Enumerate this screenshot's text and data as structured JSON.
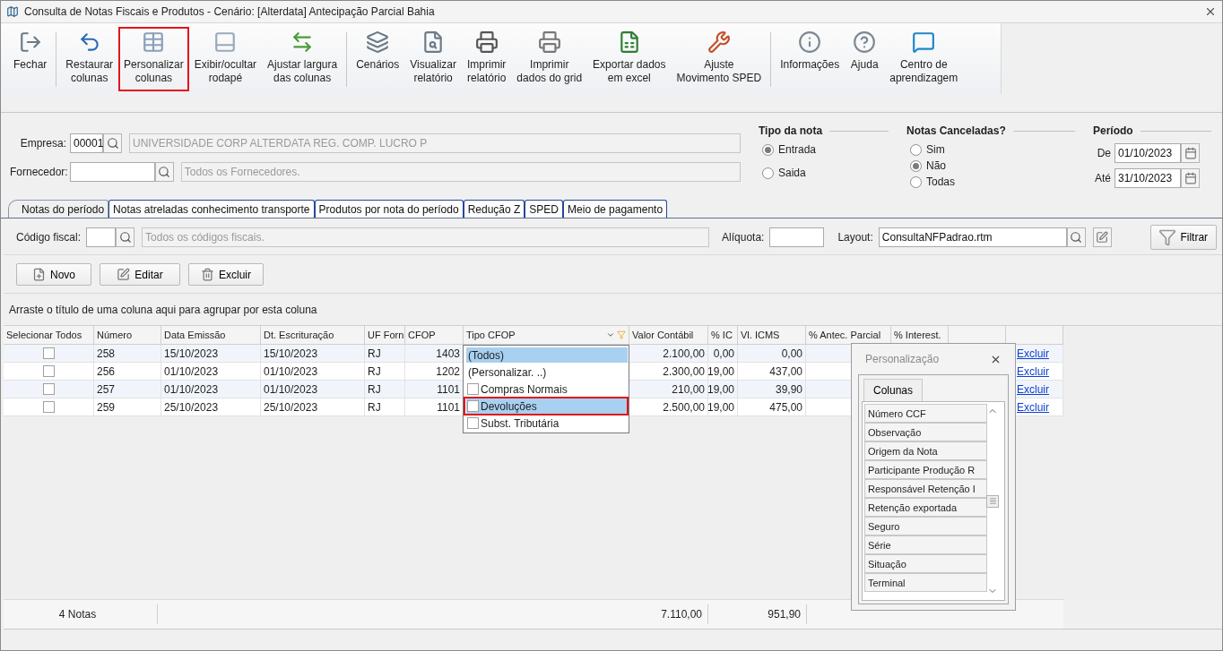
{
  "window": {
    "title": "Consulta de Notas Fiscais e Produtos - Cenário: [Alterdata] Antecipação Parcial Bahia"
  },
  "toolbar": [
    {
      "label": "Fechar",
      "separator_before": false,
      "highlighted": false
    },
    {
      "label": "Restaurar\ncolunas",
      "separator_before": true,
      "highlighted": false
    },
    {
      "label": "Personalizar\ncolunas",
      "separator_before": false,
      "highlighted": true
    },
    {
      "label": "Exibir/ocultar\nrodapé",
      "separator_before": false,
      "highlighted": false
    },
    {
      "label": "Ajustar largura\ndas colunas",
      "separator_before": false,
      "highlighted": false
    },
    {
      "label": "Cenários",
      "separator_before": true,
      "highlighted": false
    },
    {
      "label": "Visualizar\nrelatório",
      "separator_before": false,
      "highlighted": false
    },
    {
      "label": "Imprimir\nrelatório",
      "separator_before": false,
      "highlighted": false
    },
    {
      "label": "Imprimir\ndados do grid",
      "separator_before": false,
      "highlighted": false
    },
    {
      "label": "Exportar dados\nem excel",
      "separator_before": false,
      "highlighted": false
    },
    {
      "label": "Ajuste\nMovimento SPED",
      "separator_before": false,
      "highlighted": false
    },
    {
      "label": "Informações",
      "separator_before": true,
      "highlighted": false
    },
    {
      "label": "Ajuda",
      "separator_before": false,
      "highlighted": false
    },
    {
      "label": "Centro de\naprendizagem",
      "separator_before": false,
      "highlighted": false
    }
  ],
  "empresa": {
    "label": "Empresa:",
    "code": "00001",
    "description": "UNIVERSIDADE CORP ALTERDATA REG. COMP. LUCRO P"
  },
  "fornecedor": {
    "label": "Fornecedor:",
    "description": "Todos os Fornecedores."
  },
  "tipo_nota": {
    "title": "Tipo da nota",
    "options": [
      {
        "label": "Entrada",
        "selected": true
      },
      {
        "label": "Saida",
        "selected": false
      }
    ]
  },
  "notas_canceladas": {
    "title": "Notas Canceladas?",
    "options": [
      {
        "label": "Sim",
        "selected": false
      },
      {
        "label": "Não",
        "selected": true
      },
      {
        "label": "Todas",
        "selected": false
      }
    ]
  },
  "periodo": {
    "title": "Período",
    "from": {
      "label": "De",
      "value": "01/10/2023"
    },
    "to": {
      "label": "Até",
      "value": "31/10/2023"
    }
  },
  "tabs": [
    {
      "label": "Notas do período",
      "selected": true
    },
    {
      "label": "Notas atreladas conhecimento transporte",
      "selected": false
    },
    {
      "label": "Produtos por nota do período",
      "selected": false
    },
    {
      "label": "Redução Z",
      "selected": false
    },
    {
      "label": "SPED",
      "selected": false
    },
    {
      "label": "Meio de pagamento",
      "selected": false
    }
  ],
  "codigo_fiscal": {
    "label": "Código fiscal:",
    "description": "Todos os códigos fiscais."
  },
  "aliquota": {
    "label": "Alíquota:"
  },
  "layout": {
    "label": "Layout:",
    "value": "ConsultaNFPadrao.rtm"
  },
  "filter_button": "Filtrar",
  "actions": [
    "Novo",
    "Editar",
    "Excluir"
  ],
  "group_hint": "Arraste o título de uma coluna aqui para agrupar por esta coluna",
  "table": {
    "columns": [
      "Selecionar Todos",
      "Número",
      "Data Emissão",
      "Dt. Escrituração",
      "UF Forn",
      "CFOP",
      "Tipo CFOP",
      "Valor Contábil",
      "% IC",
      "Vl. ICMS",
      "% Antec. Parcial",
      "% Interest."
    ],
    "rows": [
      {
        "checked": false,
        "numero": "258",
        "data_emissao": "15/10/2023",
        "dt_escrituracao": "15/10/2023",
        "uf": "RJ",
        "cfop": "1403",
        "valor_contabil": "2.100,00",
        "icms_pct": "0,00",
        "vl_icms": "0,00",
        "action": "Excluir"
      },
      {
        "checked": false,
        "numero": "256",
        "data_emissao": "01/10/2023",
        "dt_escrituracao": "01/10/2023",
        "uf": "RJ",
        "cfop": "1202",
        "valor_contabil": "2.300,00",
        "icms_pct": "19,00",
        "vl_icms": "437,00",
        "action": "Excluir"
      },
      {
        "checked": false,
        "numero": "257",
        "data_emissao": "01/10/2023",
        "dt_escrituracao": "01/10/2023",
        "uf": "RJ",
        "cfop": "1101",
        "valor_contabil": "210,00",
        "icms_pct": "19,00",
        "vl_icms": "39,90",
        "action": "Excluir"
      },
      {
        "checked": false,
        "numero": "259",
        "data_emissao": "25/10/2023",
        "dt_escrituracao": "25/10/2023",
        "uf": "RJ",
        "cfop": "1101",
        "valor_contabil": "2.500,00",
        "icms_pct": "19,00",
        "vl_icms": "475,00",
        "action": "Excluir"
      }
    ],
    "footer": {
      "count": "4 Notas",
      "valor_contabil": "7.110,00",
      "vl_icms": "951,90"
    }
  },
  "filter_dropdown": [
    {
      "kind": "option",
      "label": "(Todos)",
      "selected": true,
      "highlighted": false
    },
    {
      "kind": "option",
      "label": "(Personalizar. ..)",
      "selected": false,
      "highlighted": false
    },
    {
      "kind": "check",
      "label": "Compras Normais",
      "checked": false,
      "selected": false,
      "highlighted": false
    },
    {
      "kind": "check",
      "label": "Devoluções",
      "checked": false,
      "selected": true,
      "highlighted": true
    },
    {
      "kind": "check",
      "label": "Subst. Tributária",
      "checked": false,
      "selected": false,
      "highlighted": false
    }
  ],
  "personalization": {
    "title": "Personalização",
    "tab": "Colunas",
    "items": [
      "Número CCF",
      "Observação",
      "Origem da Nota",
      "Participante Produção R",
      "Responsável Retenção I",
      "Retenção exportada",
      "Seguro",
      "Série",
      "Situação",
      "Terminal"
    ]
  }
}
